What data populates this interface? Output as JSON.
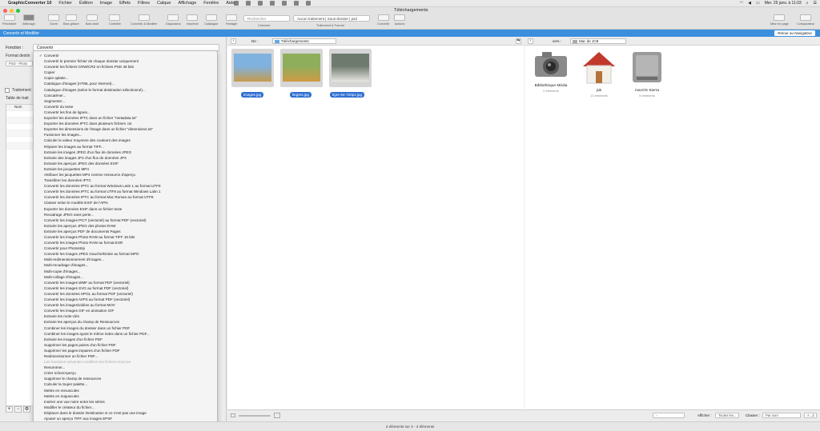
{
  "menubar": {
    "app": "GraphicConverter 10",
    "items": [
      "Fichier",
      "Édition",
      "Image",
      "Effets",
      "Filtres",
      "Calque",
      "Affichage",
      "Fenêtre",
      "Aide"
    ],
    "clock": "Mer. 25 janv. à 11:03"
  },
  "window": {
    "title": "Téléchargements"
  },
  "toolbar": {
    "items": [
      "Précédent",
      "Affichage",
      "Ouvrir",
      "Bars glisser",
      "Bars droit",
      "Corbeille",
      "Convertir & Modifier",
      "Diaporama",
      "Imprimer",
      "Catalogue",
      "Partager",
      "Chercher",
      "Traitement & Format",
      "Convertir",
      "Actions",
      "Mise en page",
      "Comparateur"
    ],
    "search_placeholder": "Rechercher",
    "processing_value": "Aucun traitement | Sous-dossier | psd"
  },
  "bluebar": {
    "title": "Convertir et Modifier",
    "back_button": "Retour au Navigateur"
  },
  "left": {
    "function_label": "Fonction :",
    "function_value": "Convertir",
    "format_label": "Format destin",
    "format_value": "PSD - Photo",
    "treatment_label": "Traitement",
    "table_label": "Table de trait",
    "name_col": "Nom"
  },
  "menu": {
    "items": [
      "Convertir",
      "Convertir le premier fichier de chaque dossier uniquement",
      "Convertir les fichiers CRW/CR2 en fichiers PSD 48 bits",
      "Copier",
      "Copie aplatie...",
      "Catalogue d'images (HTML pour Internet)...",
      "Catalogue d'images (selon le format destination sélectionné)...",
      "Concaténer...",
      "Segmenter...",
      "Convertir du texte",
      "Convertir les fins de lignes...",
      "Exporter les données IPTC dans un fichier \"metadata.txt\"",
      "Exporter les données IPTC dans plusieurs fichiers .txt",
      "Exporter les dimensions de l'image dans un fichier \"dimensions.txt\"",
      "Fusionner les images...",
      "Calculer la valeur moyenne des couleurs des images",
      "Réparer les images au format TIFF...",
      "Extraire les images JPEG d'un flux de données JPEG",
      "Extraire des images JP2 d'un flux de données JPX",
      "Extraire les aperçus JPEG des données EXIF",
      "Extraire les jacquettes MP4",
      "Attribuer les jacquettes MP4 comme ressource d'aperçu",
      "Transférer les données IPTC",
      "Convertir les données IPTC au format Windows Latin 1 au format UTF8",
      "Convertir les données IPTC au format UTF8 au format Windows Latin 1",
      "Convertir les données IPTC au format Mac Roman au format UTF8",
      "Classer selon le modèle EXIF de l'APN",
      "Exporter les données EXIF dans un fichier texte",
      "Recadrage JPEG sans perte...",
      "Convertir les images PICT (vectoriel) au format PDF (vectoriel)",
      "Extraire les aperçus JPEG des photos RAW",
      "Extraire les aperçus PDF de documents Pages",
      "Convertir les images Photo RAW au format TIFF 16 bits",
      "Convertir les images Photo RAW au format EXR",
      "Convertir pour Photostrip",
      "Convertir les images JPEG Gauche/Droite au format MPO",
      "Multi-redimensionnement d'images...",
      "Multi-recadrage d'images...",
      "Multi-copie d'images...",
      "Multi-collage d'images...",
      "Convertir les images WMF au format PDF (vectoriel)",
      "Convertir les images SVG au format PDF (vectoriel)",
      "Convertir les données HPGL au format PDF (vectoriel)",
      "Convertir les images AI/PS au format PDF (vectoriel)",
      "Convertir les images/vidéos au format MOV",
      "Convertir les images GIF en animation GIF",
      "Extraire les mots-clés",
      "Extraire les aperçus du champ de Ressources",
      "Combiner les images du dossier dans un fichier PDF",
      "Combiner les images ayant le même index dans un fichier PDF...",
      "Extraire les images d'un fichier PDF",
      "Supprimer les pages paires d'un fichier PDF",
      "Supprimer les pages impaires d'un fichier PDF",
      "Redimensionner un fichier PDF...",
      "Les fonctions suivantes modifient les fichiers sources",
      "Renommer...",
      "Créer Icône/Aperçu",
      "Supprimer le champ de ressources",
      "Calculer la Super palette...",
      "Mettre en minuscules",
      "Mettre en majuscules",
      "Insérer une vue noire entre les séries",
      "Modifier le créateur du fichier...",
      "Déplacer dans le dossier Destination si ce n'est pas une image",
      "Ajouter un aperçu TIFF aux images EPSF"
    ],
    "disabled_index": 54,
    "checked_index": 0
  },
  "left_nav": {
    "de_label": "De :",
    "folder": "Téléchargements"
  },
  "right_nav": {
    "vers_label": "vers :",
    "folder": "Mac de JCB"
  },
  "thumbs": [
    {
      "name": "images.jpg",
      "colors": [
        "#7fb2de",
        "#c69b4e"
      ]
    },
    {
      "name": "lingres.jpg",
      "colors": [
        "#8fae5c",
        "#d09a45"
      ]
    },
    {
      "name": "tigre-84-720px.jpg",
      "colors": [
        "#6f7a6e",
        "#e6e6e0"
      ]
    }
  ],
  "volumes": [
    {
      "name": "Bibliothèque Média",
      "sub": "0 éléments",
      "icon": "camera-icon"
    },
    {
      "name": "job",
      "sub": "13 éléments",
      "icon": "home-icon"
    },
    {
      "name": "macOS Sierra",
      "sub": "5 éléments",
      "icon": "disk-icon"
    }
  ],
  "bottom": {
    "afficher_label": "Afficher :",
    "afficher_value": "Toutes les...",
    "classer_label": "Classer :",
    "classer_value": "Par nom",
    "order_value": "A...Z"
  },
  "status": "3 éléments sur 3 - 3 éléments"
}
